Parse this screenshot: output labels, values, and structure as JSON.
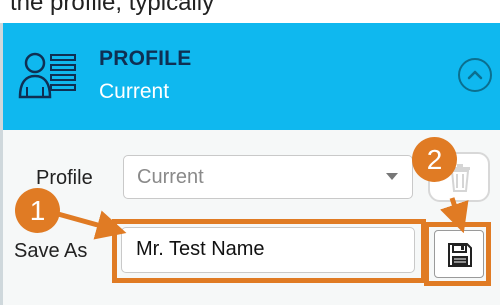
{
  "top_strip": {
    "text": "the profile, typically"
  },
  "header": {
    "title": "PROFILE",
    "subtitle": "Current",
    "icon": "profile-list-icon",
    "collapse_icon": "chevron-up-icon"
  },
  "form": {
    "profile_label": "Profile",
    "profile_value": "Current",
    "save_as_label": "Save As",
    "save_as_value": "Mr. Test Name",
    "delete_icon": "trash-icon",
    "save_icon": "floppy-disk-icon"
  },
  "annotations": {
    "callout_1": "1",
    "callout_2": "2",
    "accent": "#e07b24"
  },
  "colors": {
    "header_bg": "#0fb8ef",
    "title": "#0f2f53"
  }
}
